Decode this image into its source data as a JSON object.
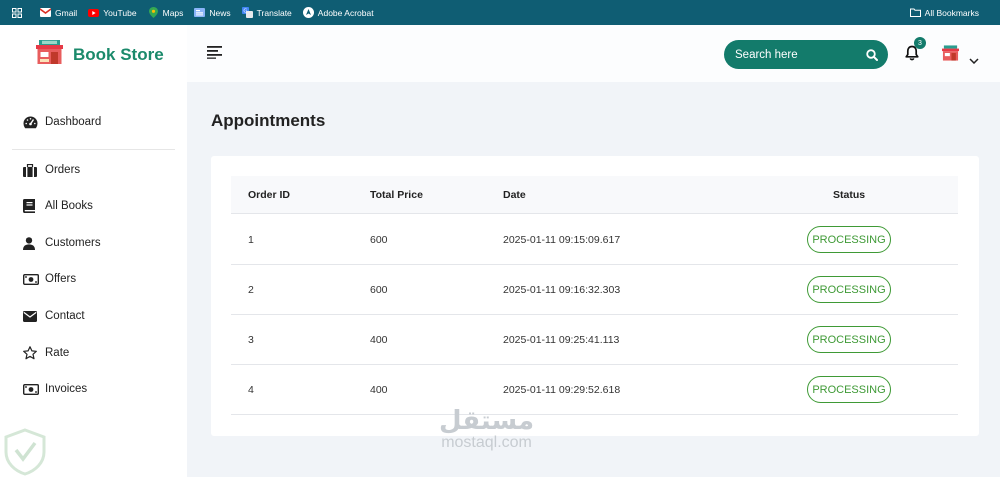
{
  "browser": {
    "bookmarks": [
      {
        "label": "Gmail",
        "icon": "gmail-icon"
      },
      {
        "label": "YouTube",
        "icon": "youtube-icon"
      },
      {
        "label": "Maps",
        "icon": "maps-icon"
      },
      {
        "label": "News",
        "icon": "news-icon"
      },
      {
        "label": "Translate",
        "icon": "translate-icon"
      },
      {
        "label": "Adobe Acrobat",
        "icon": "acrobat-icon"
      }
    ],
    "all_bookmarks_label": "All Bookmarks"
  },
  "app": {
    "title": "Book Store",
    "accent_color": "#137b6b",
    "brand_color": "#1b8a6b"
  },
  "sidebar": {
    "items": [
      {
        "label": "Dashboard",
        "icon": "dashboard-icon"
      },
      {
        "label": "Orders",
        "icon": "briefcase-icon"
      },
      {
        "label": "All Books",
        "icon": "book-icon"
      },
      {
        "label": "Customers",
        "icon": "user-icon"
      },
      {
        "label": "Offers",
        "icon": "money-icon"
      },
      {
        "label": "Contact",
        "icon": "envelope-icon"
      },
      {
        "label": "Rate",
        "icon": "star-icon"
      },
      {
        "label": "Invoices",
        "icon": "invoice-icon"
      }
    ]
  },
  "header": {
    "search_placeholder": "Search here",
    "notification_count": "3"
  },
  "main": {
    "title": "Appointments",
    "table": {
      "columns": [
        "Order ID",
        "Total Price",
        "Date",
        "Status"
      ],
      "rows": [
        {
          "id": "1",
          "price": "600",
          "date": "2025-01-11 09:15:09.617",
          "status": "PROCESSING"
        },
        {
          "id": "2",
          "price": "600",
          "date": "2025-01-11 09:16:32.303",
          "status": "PROCESSING"
        },
        {
          "id": "3",
          "price": "400",
          "date": "2025-01-11 09:25:41.113",
          "status": "PROCESSING"
        },
        {
          "id": "4",
          "price": "400",
          "date": "2025-01-11 09:29:52.618",
          "status": "PROCESSING"
        }
      ]
    },
    "status_color": "#3f9a36"
  },
  "watermark": {
    "arabic": "مستقل",
    "latin": "mostaql.com"
  }
}
